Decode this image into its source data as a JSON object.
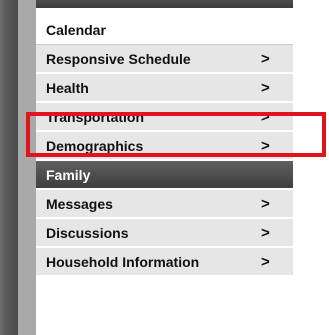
{
  "menu": {
    "items": [
      {
        "label": "Calendar",
        "chevron": ""
      },
      {
        "label": "Responsive Schedule",
        "chevron": ">"
      },
      {
        "label": "Health",
        "chevron": ">"
      },
      {
        "label": "Transportation",
        "chevron": ">"
      },
      {
        "label": "Demographics",
        "chevron": ">"
      },
      {
        "label": "Family",
        "chevron": ""
      },
      {
        "label": "Messages",
        "chevron": ">"
      },
      {
        "label": "Discussions",
        "chevron": ">"
      },
      {
        "label": "Household Information",
        "chevron": ">"
      }
    ]
  },
  "colors": {
    "highlight": "#e0141e",
    "header_bg": "#4f4f4f",
    "item_bg": "#e6e6e6"
  },
  "icons": {
    "chevron": "chevron-right-icon"
  }
}
